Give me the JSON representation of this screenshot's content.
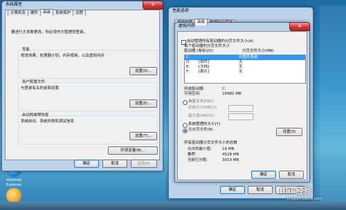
{
  "desktop": {
    "icons": [
      {
        "label": "Internet Explorer",
        "color": "#2a7fd4"
      },
      {
        "label": "",
        "color": "#f2a42b"
      }
    ]
  },
  "sys_props": {
    "title": "系统属性",
    "close_glyph": "✕",
    "tabs": [
      "计算机名",
      "硬件",
      "高级",
      "系统保护",
      "远程"
    ],
    "active_tab": 2,
    "note": "要进行大多数更改，你必须作为管理员登录。",
    "performance": {
      "title": "性能",
      "desc": "视觉效果，处理器计划，内存使用，以及虚拟内存",
      "button": "设置(S)..."
    },
    "profiles": {
      "title": "用户配置文件",
      "desc": "与登录有关的桌面设置",
      "button": "设置(E)..."
    },
    "startup": {
      "title": "启动和故障恢复",
      "desc": "系统启动、系统失败和调试信息",
      "button": "设置(T)..."
    },
    "env_button": "环境变量(N)...",
    "ok": "确定",
    "cancel": "取消",
    "apply": "应用(A)"
  },
  "perf_options": {
    "title": "性能选项",
    "tabs": [
      "视觉效果",
      "高级",
      "数据执行保护"
    ],
    "active_tab": 1
  },
  "vmem": {
    "title": "虚拟内存",
    "close_glyph": "✕",
    "auto_manage_label": "自动管理所有驱动器的分页文件大小(A)",
    "per_drive_label": "每个驱动器的分页文件大小",
    "col_drive": "驱动器 [卷标](D)",
    "col_size": "分页文件大小(MB)",
    "drives": [
      {
        "drive": "C:",
        "label": "",
        "size": "托管的系统"
      },
      {
        "drive": "D:",
        "label": "[软件]",
        "size": "无"
      },
      {
        "drive": "E:",
        "label": "[文档]",
        "size": "无"
      },
      {
        "drive": "F:",
        "label": "[娱乐]",
        "size": "无"
      }
    ],
    "selected_drive_label": "所选驱动器:",
    "selected_drive_value": "C:",
    "free_space_label": "可用空间:",
    "free_space_value": "16981 MB",
    "custom_size_label": "自定义大小(C):",
    "initial_label": "初始大小(MB)(I):",
    "max_label": "最大值(MB)(X):",
    "system_managed_label": "系统管理的大小(Y)",
    "no_paging_label": "无分页文件(N)",
    "set_button": "设置(S)",
    "totals_title": "所有驱动器分页文件大小的总数",
    "min_allowed_label": "允许的最小值:",
    "min_allowed_value": "16 MB",
    "recommended_label": "推荐:",
    "recommended_value": "4528 MB",
    "allocated_label": "当前已分配:",
    "allocated_value": "3019 MB",
    "ok": "确定",
    "cancel": "取消"
  },
  "perf_footer": {
    "ok": "确定",
    "cancel": "取消",
    "apply": "应用(A)"
  },
  "watermark": {
    "text": "Bai 经验",
    "url": "jingyan.baidu.com"
  }
}
